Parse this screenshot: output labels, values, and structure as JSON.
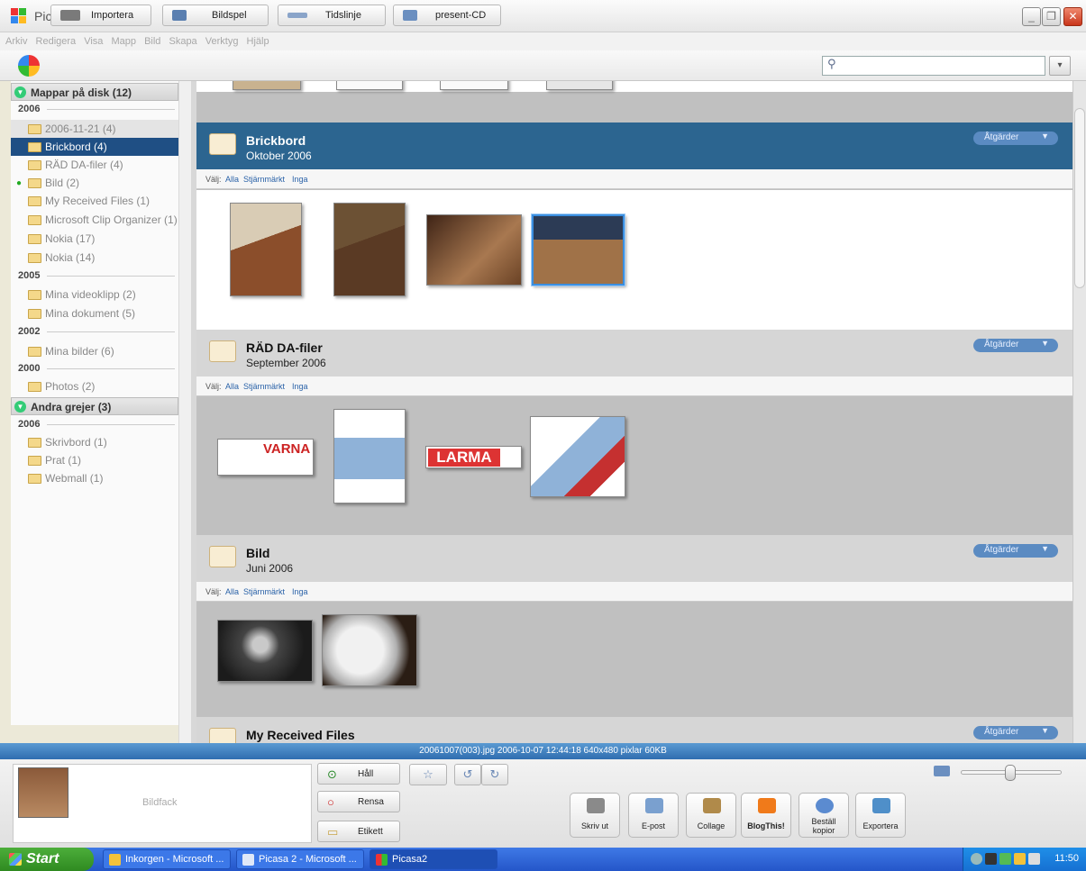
{
  "window": {
    "title": "Picasa2"
  },
  "menu": [
    "Arkiv",
    "Redigera",
    "Visa",
    "Mapp",
    "Bild",
    "Skapa",
    "Verktyg",
    "Hjälp"
  ],
  "toolbar": {
    "import_label": "Importera",
    "slideshow_label": "Bildspel",
    "timeline_label": "Tidslinje",
    "cd_label": "present-CD"
  },
  "search": {
    "value": ""
  },
  "sidebar": {
    "group1": "Mappar på disk (12)",
    "y2006": "2006",
    "items2006": [
      "2006-11-21 (4)",
      "Brickbord (4)",
      "RÄD DA-filer (4)",
      "Bild (2)",
      "My Received Files (1)",
      "Microsoft Clip Organizer (1)",
      "Nokia (17)",
      "Nokia (14)"
    ],
    "y2005": "2005",
    "items2005": [
      "Mina videoklipp (2)",
      "Mina dokument (5)"
    ],
    "y2002": "2002",
    "items2002": [
      "Mina bilder (6)"
    ],
    "y2000": "2000",
    "items2000": [
      "Photos (2)"
    ],
    "group2": "Andra grejer (3)",
    "y2006b": "2006",
    "items_other": [
      "Skrivbord (1)",
      "Prat (1)",
      "Webmall (1)"
    ]
  },
  "main": {
    "select_prefix": "Välj:",
    "select_all": "Alla",
    "select_starred": "Stjärnmärkt",
    "select_none": "Inga",
    "actions_label": "Åtgärder",
    "folders": [
      {
        "title": "Brickbord",
        "date": "Oktober 2006"
      },
      {
        "title": "RÄD DA-filer",
        "date": "September 2006"
      },
      {
        "title": "Bild",
        "date": "Juni 2006"
      },
      {
        "title": "My Received Files",
        "date": ""
      }
    ],
    "thumb_texts": {
      "varna": "VARNA",
      "larma": "LARMA"
    }
  },
  "status": {
    "text": "20061007(003).jpg   2006-10-07 12:44:18   640x480 pixlar   60KB"
  },
  "tray": {
    "label": "Bildfack",
    "hold": "Håll",
    "clear": "Rensa",
    "tag": "Etikett"
  },
  "actions": {
    "print": "Skriv ut",
    "email": "E-post",
    "collage": "Collage",
    "blog": "BlogThis!",
    "order1": "Beställ",
    "order2": "kopior",
    "export": "Exportera"
  },
  "taskbar": {
    "start": "Start",
    "tasks": [
      "Inkorgen - Microsoft ...",
      "Picasa 2 - Microsoft ...",
      "Picasa2"
    ],
    "clock": "11:50"
  }
}
